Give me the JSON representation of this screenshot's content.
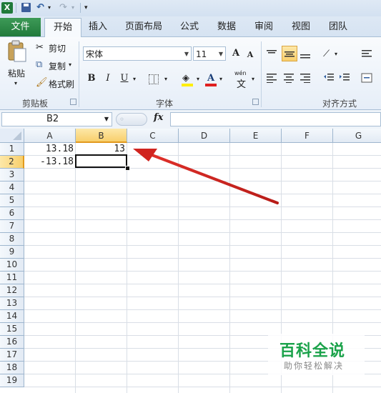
{
  "qat": {
    "logo": "X",
    "undo": "↶",
    "redo": "↷",
    "customize": "▾"
  },
  "tabs": [
    "文件",
    "开始",
    "插入",
    "页面布局",
    "公式",
    "数据",
    "审阅",
    "视图",
    "团队"
  ],
  "clipboard": {
    "paste": "粘贴",
    "cut": "剪切",
    "copy": "复制",
    "format_painter": "格式刷",
    "group": "剪贴板"
  },
  "font": {
    "name": "宋体",
    "size": "11",
    "bold": "B",
    "italic": "I",
    "underline": "U",
    "grow": "A",
    "shrink": "A",
    "font_color": "A",
    "wen": "wén",
    "wen_char": "文",
    "group": "字体"
  },
  "alignment": {
    "group": "对齐方式"
  },
  "formula_bar": {
    "name_box": "B2",
    "fx": "fx",
    "content": ""
  },
  "columns": [
    "A",
    "B",
    "C",
    "D",
    "E",
    "F",
    "G"
  ],
  "selected_column": "B",
  "rows": [
    "1",
    "2",
    "3",
    "4",
    "5",
    "6",
    "7",
    "8",
    "9",
    "10",
    "11",
    "12",
    "13",
    "14",
    "15",
    "16",
    "17",
    "18",
    "19"
  ],
  "selected_row": "2",
  "cells": {
    "A1": "13.18",
    "B1": "13",
    "A2": "-13.18"
  },
  "active_cell": "B2",
  "watermark": {
    "title": "百科全说",
    "subtitle": "助你轻松解决"
  },
  "colors": {
    "file_tab": "#217a3b",
    "arrow": "#d0241f",
    "selection_header": "#f8cf6c",
    "watermark": "#1aa24a"
  }
}
